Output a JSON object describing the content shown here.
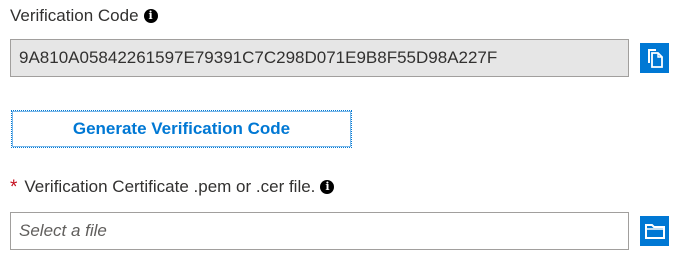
{
  "verification_code": {
    "label": "Verification Code",
    "value": "9A810A05842261597E79391C7C298D071E9B8F55D98A227F",
    "copy_icon": "copy-icon"
  },
  "generate_button": {
    "label": "Generate Verification Code"
  },
  "certificate": {
    "required_marker": "*",
    "label": "Verification Certificate .pem or .cer file.",
    "placeholder": "Select a file",
    "browse_icon": "folder-icon"
  },
  "info_glyph": "i",
  "colors": {
    "accent": "#0078d4",
    "required": "#c50f1f",
    "readonly_bg": "#e6e6e6",
    "border": "#a19f9d"
  }
}
